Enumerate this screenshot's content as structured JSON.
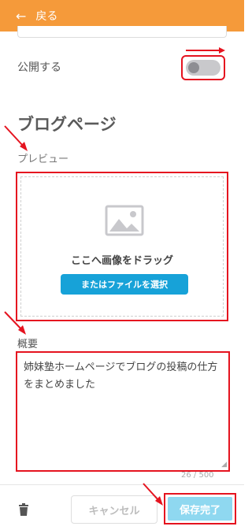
{
  "header": {
    "back_icon": "←",
    "back_label": "戻る"
  },
  "publish": {
    "label": "公開する",
    "toggle_on": false
  },
  "section": {
    "title": "ブログページ"
  },
  "preview": {
    "label": "プレビュー",
    "drag_text": "ここへ画像をドラッグ",
    "select_button": "またはファイルを選択"
  },
  "summary": {
    "label": "概要",
    "value": "姉妹塾ホームページでブログの投稿の仕方をまとめました",
    "counter": "26 / 500"
  },
  "footer": {
    "cancel_label": "キャンセル",
    "save_label": "保存完了"
  },
  "colors": {
    "header": "#f59a3a",
    "annotation": "#e5131f",
    "select_button": "#17a2d8",
    "save_button": "#8fd8f0"
  }
}
